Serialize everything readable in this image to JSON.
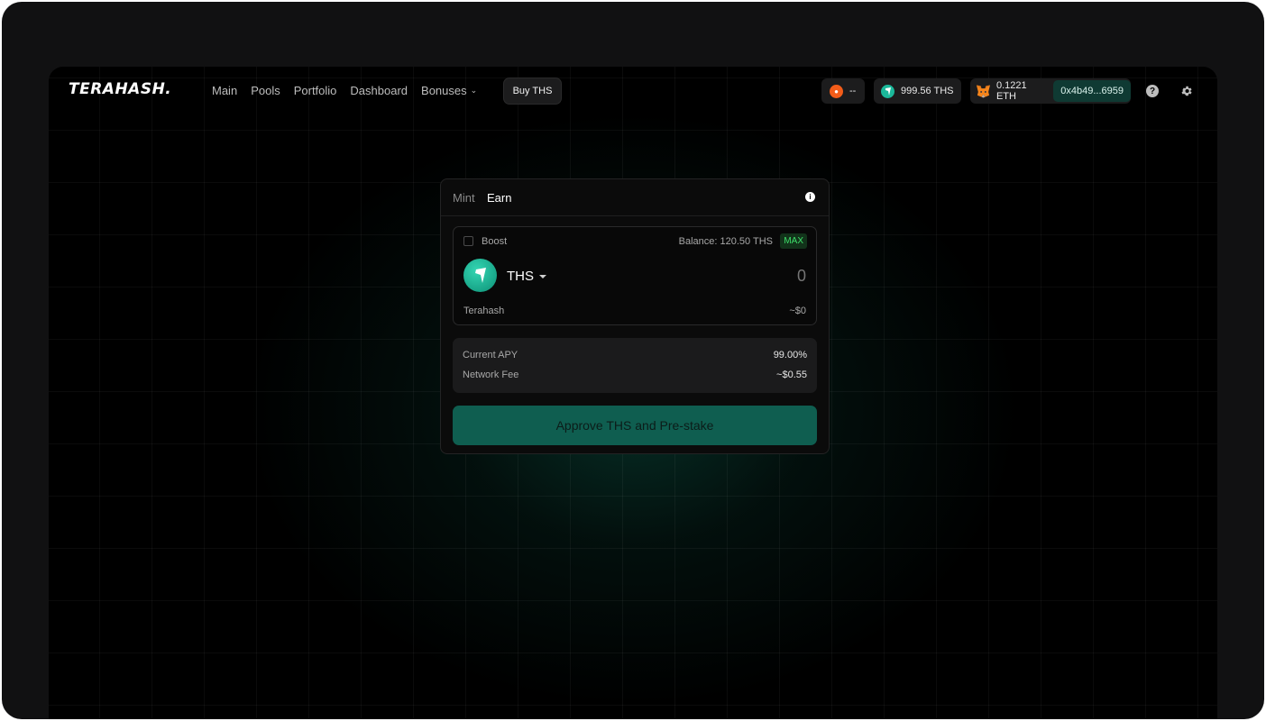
{
  "brand": {
    "logo_text": "TERAHASH."
  },
  "nav": {
    "items": [
      {
        "label": "Main"
      },
      {
        "label": "Pools"
      },
      {
        "label": "Portfolio"
      },
      {
        "label": "Dashboard"
      },
      {
        "label": "Bonuses"
      }
    ],
    "buy_label": "Buy THS"
  },
  "header_right": {
    "points_value": "--",
    "ths_balance": "999.56 THS",
    "eth_balance": "0.1221 ETH",
    "wallet_address": "0x4b49...6959",
    "icons": [
      "points-icon",
      "ths-token-icon",
      "metamask-fox-icon",
      "help-icon",
      "gear-icon"
    ]
  },
  "card": {
    "tabs": [
      {
        "label": "Mint",
        "active": false
      },
      {
        "label": "Earn",
        "active": true
      }
    ],
    "input": {
      "boost_label": "Boost",
      "boost_checked": false,
      "balance_text": "Balance: 120.50 THS",
      "max_label": "MAX",
      "token_symbol": "THS",
      "token_name": "Terahash",
      "amount_value": "",
      "amount_placeholder": "0",
      "usd_value": "~$0"
    },
    "stats": [
      {
        "label": "Current APY",
        "value": "99.00%"
      },
      {
        "label": "Network Fee",
        "value": "~$0.55"
      }
    ],
    "action_label": "Approve THS and Pre-stake"
  },
  "colors": {
    "accent": "#1bb89a",
    "button_bg": "#0f5e50",
    "max_green": "#3ee06a",
    "points_orange": "#f25c19"
  }
}
